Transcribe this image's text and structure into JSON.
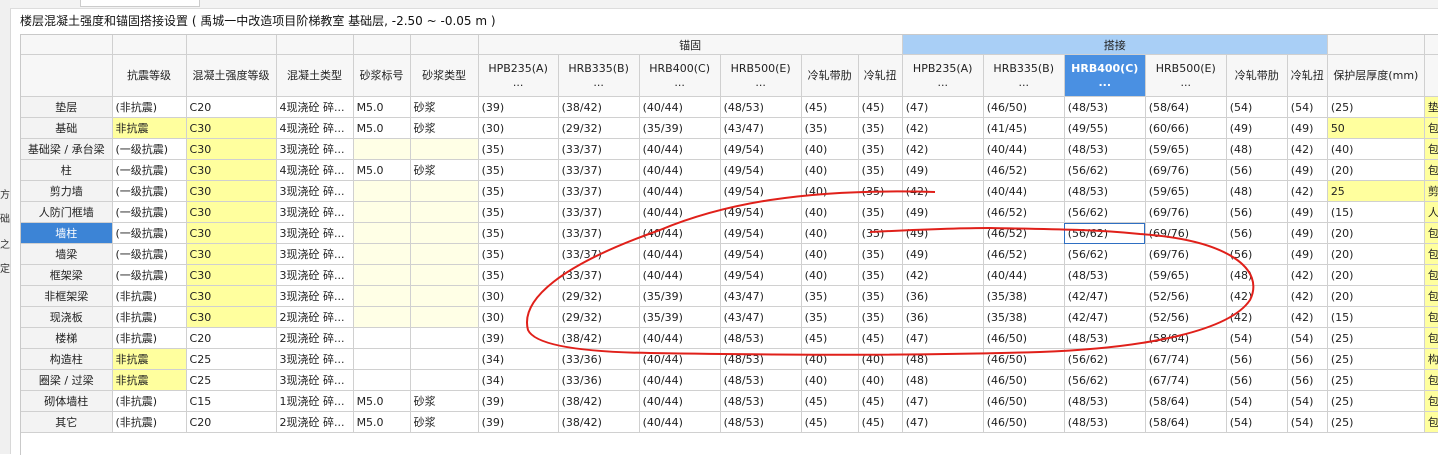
{
  "page": {
    "title": "楼层混凝土强度和锚固搭接设置 ( 禹城一中改造项目阶梯教室  基础层, -2.50 ~ -0.05 m )",
    "left_labels": [
      "方",
      "础",
      "之",
      "定"
    ]
  },
  "table": {
    "group_headers": {
      "anchorage": "锚固",
      "lap": "搭接"
    },
    "columns": [
      "",
      "抗震等级",
      "混凝土强度等级",
      "混凝土类型",
      "砂浆标号",
      "砂浆类型",
      "HPB235(A)\n...",
      "HRB335(B)\n...",
      "HRB400(C)\n...",
      "HRB500(E)\n...",
      "冷轧带肋",
      "冷轧扭",
      "HPB235(A)\n...",
      "HRB335(B)\n...",
      "HRB400(C)\n...",
      "HRB500(E)\n...",
      "冷轧带肋",
      "冷轧扭",
      "保护层厚度(mm)",
      ""
    ],
    "rows": [
      [
        "垫层",
        "(非抗震)",
        "C20",
        "4现浇砼 碎...",
        "M5.0",
        "砂浆",
        "(39)",
        "(38/42)",
        "(40/44)",
        "(48/53)",
        "(45)",
        "(45)",
        "(47)",
        "(46/50)",
        "(48/53)",
        "(58/64)",
        "(54)",
        "(54)",
        "(25)",
        "垫"
      ],
      [
        "基础",
        "非抗震",
        "C30",
        "4现浇砼 碎...",
        "M5.0",
        "砂浆",
        "(30)",
        "(29/32)",
        "(35/39)",
        "(43/47)",
        "(35)",
        "(35)",
        "(42)",
        "(41/45)",
        "(49/55)",
        "(60/66)",
        "(49)",
        "(49)",
        "50",
        "包"
      ],
      [
        "基础梁 / 承台梁",
        "(一级抗震)",
        "C30",
        "3现浇砼 碎...",
        "",
        "",
        "(35)",
        "(33/37)",
        "(40/44)",
        "(49/54)",
        "(40)",
        "(35)",
        "(42)",
        "(40/44)",
        "(48/53)",
        "(59/65)",
        "(48)",
        "(42)",
        "(40)",
        "包"
      ],
      [
        "柱",
        "(一级抗震)",
        "C30",
        "4现浇砼 碎...",
        "M5.0",
        "砂浆",
        "(35)",
        "(33/37)",
        "(40/44)",
        "(49/54)",
        "(40)",
        "(35)",
        "(49)",
        "(46/52)",
        "(56/62)",
        "(69/76)",
        "(56)",
        "(49)",
        "(20)",
        "包"
      ],
      [
        "剪力墙",
        "(一级抗震)",
        "C30",
        "3现浇砼 碎...",
        "",
        "",
        "(35)",
        "(33/37)",
        "(40/44)",
        "(49/54)",
        "(40)",
        "(35)",
        "(42)",
        "(40/44)",
        "(48/53)",
        "(59/65)",
        "(48)",
        "(42)",
        "25",
        "剪"
      ],
      [
        "人防门框墙",
        "(一级抗震)",
        "C30",
        "3现浇砼 碎...",
        "",
        "",
        "(35)",
        "(33/37)",
        "(40/44)",
        "(49/54)",
        "(40)",
        "(35)",
        "(49)",
        "(46/52)",
        "(56/62)",
        "(69/76)",
        "(56)",
        "(49)",
        "(15)",
        "人"
      ],
      [
        "墙柱",
        "(一级抗震)",
        "C30",
        "3现浇砼 碎...",
        "",
        "",
        "(35)",
        "(33/37)",
        "(40/44)",
        "(49/54)",
        "(40)",
        "(35)",
        "(49)",
        "(46/52)",
        "(56/62)",
        "(69/76)",
        "(56)",
        "(49)",
        "(20)",
        "包"
      ],
      [
        "墙梁",
        "(一级抗震)",
        "C30",
        "3现浇砼 碎...",
        "",
        "",
        "(35)",
        "(33/37)",
        "(40/44)",
        "(49/54)",
        "(40)",
        "(35)",
        "(49)",
        "(46/52)",
        "(56/62)",
        "(69/76)",
        "(56)",
        "(49)",
        "(20)",
        "包"
      ],
      [
        "框架梁",
        "(一级抗震)",
        "C30",
        "3现浇砼 碎...",
        "",
        "",
        "(35)",
        "(33/37)",
        "(40/44)",
        "(49/54)",
        "(40)",
        "(35)",
        "(42)",
        "(40/44)",
        "(48/53)",
        "(59/65)",
        "(48)",
        "(42)",
        "(20)",
        "包"
      ],
      [
        "非框架梁",
        "(非抗震)",
        "C30",
        "3现浇砼 碎...",
        "",
        "",
        "(30)",
        "(29/32)",
        "(35/39)",
        "(43/47)",
        "(35)",
        "(35)",
        "(36)",
        "(35/38)",
        "(42/47)",
        "(52/56)",
        "(42)",
        "(42)",
        "(20)",
        "包"
      ],
      [
        "现浇板",
        "(非抗震)",
        "C30",
        "2现浇砼 碎...",
        "",
        "",
        "(30)",
        "(29/32)",
        "(35/39)",
        "(43/47)",
        "(35)",
        "(35)",
        "(36)",
        "(35/38)",
        "(42/47)",
        "(52/56)",
        "(42)",
        "(42)",
        "(15)",
        "包"
      ],
      [
        "楼梯",
        "(非抗震)",
        "C20",
        "2现浇砼 碎...",
        "",
        "",
        "(39)",
        "(38/42)",
        "(40/44)",
        "(48/53)",
        "(45)",
        "(45)",
        "(47)",
        "(46/50)",
        "(48/53)",
        "(58/64)",
        "(54)",
        "(54)",
        "(25)",
        "包"
      ],
      [
        "构造柱",
        "非抗震",
        "C25",
        "3现浇砼 碎...",
        "",
        "",
        "(34)",
        "(33/36)",
        "(40/44)",
        "(48/53)",
        "(40)",
        "(40)",
        "(48)",
        "(46/50)",
        "(56/62)",
        "(67/74)",
        "(56)",
        "(56)",
        "(25)",
        "构"
      ],
      [
        "圈梁 / 过梁",
        "非抗震",
        "C25",
        "3现浇砼 碎...",
        "",
        "",
        "(34)",
        "(33/36)",
        "(40/44)",
        "(48/53)",
        "(40)",
        "(40)",
        "(48)",
        "(46/50)",
        "(56/62)",
        "(67/74)",
        "(56)",
        "(56)",
        "(25)",
        "包"
      ],
      [
        "砌体墙柱",
        "(非抗震)",
        "C15",
        "1现浇砼 碎...",
        "M5.0",
        "砂浆",
        "(39)",
        "(38/42)",
        "(40/44)",
        "(48/53)",
        "(45)",
        "(45)",
        "(47)",
        "(46/50)",
        "(48/53)",
        "(58/64)",
        "(54)",
        "(54)",
        "(25)",
        "包"
      ],
      [
        "其它",
        "(非抗震)",
        "C20",
        "2现浇砼 碎...",
        "M5.0",
        "砂浆",
        "(39)",
        "(38/42)",
        "(40/44)",
        "(48/53)",
        "(45)",
        "(45)",
        "(47)",
        "(46/50)",
        "(48/53)",
        "(58/64)",
        "(54)",
        "(54)",
        "(25)",
        "包"
      ]
    ],
    "selected_row": 6,
    "selected_column": 14,
    "highlight": {
      "yellow": "#ffff9e",
      "pale_yellow": "#ffffe6",
      "lap_header": "#a9cff6",
      "selected": "#4a90e2",
      "annotation": "#e0201a"
    }
  }
}
